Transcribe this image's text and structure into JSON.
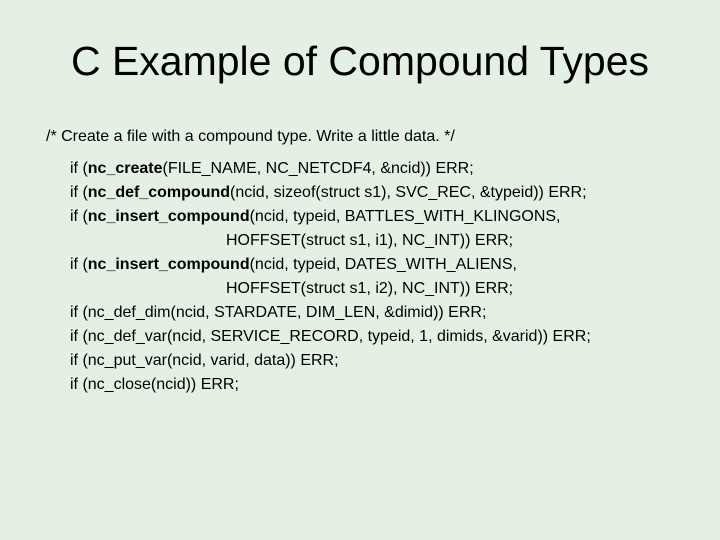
{
  "title": "C Example of Compound Types",
  "comment": "/* Create a file with a compound type. Write a little data. */",
  "lines": [
    {
      "pre": "if (",
      "bold": "nc_create",
      "post": "(FILE_NAME, NC_NETCDF4, &ncid)) ERR;",
      "indent": false
    },
    {
      "pre": "if (",
      "bold": "nc_def_compound",
      "post": "(ncid, sizeof(struct s1), SVC_REC, &typeid)) ERR;",
      "indent": false
    },
    {
      "pre": "if (",
      "bold": "nc_insert_compound",
      "post": "(ncid, typeid, BATTLES_WITH_KLINGONS,",
      "indent": false
    },
    {
      "pre": "",
      "bold": "",
      "post": "HOFFSET(struct s1, i1), NC_INT)) ERR;",
      "indent": true
    },
    {
      "pre": "if (",
      "bold": "nc_insert_compound",
      "post": "(ncid, typeid, DATES_WITH_ALIENS,",
      "indent": false
    },
    {
      "pre": "",
      "bold": "",
      "post": "HOFFSET(struct s1, i2), NC_INT)) ERR;",
      "indent": true
    },
    {
      "pre": "if (nc_def_dim(ncid, STARDATE, DIM_LEN, &dimid)) ERR;",
      "bold": "",
      "post": "",
      "indent": false
    },
    {
      "pre": "if (nc_def_var(ncid, SERVICE_RECORD, typeid, 1, dimids, &varid)) ERR;",
      "bold": "",
      "post": "",
      "indent": false
    },
    {
      "pre": "if (nc_put_var(ncid, varid, data)) ERR;",
      "bold": "",
      "post": "",
      "indent": false
    },
    {
      "pre": "if (nc_close(ncid)) ERR;",
      "bold": "",
      "post": "",
      "indent": false
    }
  ]
}
